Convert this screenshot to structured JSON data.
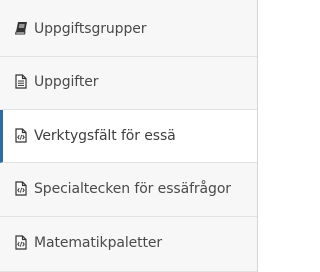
{
  "nav": {
    "items": [
      {
        "label": "Uppgiftsgrupper",
        "icon": "book-icon",
        "active": false
      },
      {
        "label": "Uppgifter",
        "icon": "document-icon",
        "active": false
      },
      {
        "label": "Verktygsfält för essä",
        "icon": "code-file-icon",
        "active": true
      },
      {
        "label": "Specialtecken för essäfrågor",
        "icon": "code-file-icon",
        "active": false
      },
      {
        "label": "Matematikpaletter",
        "icon": "code-file-icon",
        "active": false
      }
    ]
  },
  "colors": {
    "accent": "#2f6d9e",
    "text": "#4a4a4a",
    "background": "#f7f7f7",
    "active_background": "#ffffff",
    "divider": "#e3e3e3"
  }
}
